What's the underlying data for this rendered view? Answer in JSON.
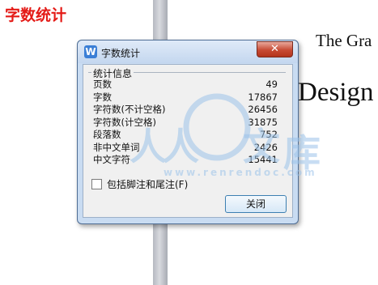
{
  "page": {
    "title": "字数统计",
    "background_text": [
      "The Gra",
      "Design"
    ]
  },
  "watermark": {
    "chars": [
      "人",
      "人",
      "文",
      "库"
    ],
    "url": "www.renrendoc.com"
  },
  "dialog": {
    "title": "字数统计",
    "app_icon_letter": "W",
    "close_glyph": "✕",
    "group_label": "统计信息",
    "stats": [
      {
        "label": "页数",
        "value": "49"
      },
      {
        "label": "字数",
        "value": "17867"
      },
      {
        "label": "字符数(不计空格)",
        "value": "26456"
      },
      {
        "label": "字符数(计空格)",
        "value": "31875"
      },
      {
        "label": "段落数",
        "value": "752"
      },
      {
        "label": "非中文单词",
        "value": "2426"
      },
      {
        "label": "中文字符",
        "value": "15441"
      }
    ],
    "checkbox_label": "包括脚注和尾注(F)",
    "checkbox_checked": false,
    "close_button_label": "关闭"
  },
  "colors": {
    "title_red": "#e41b17",
    "watermark_blue": "#9cc3ea",
    "close_red": "#c74a33"
  }
}
